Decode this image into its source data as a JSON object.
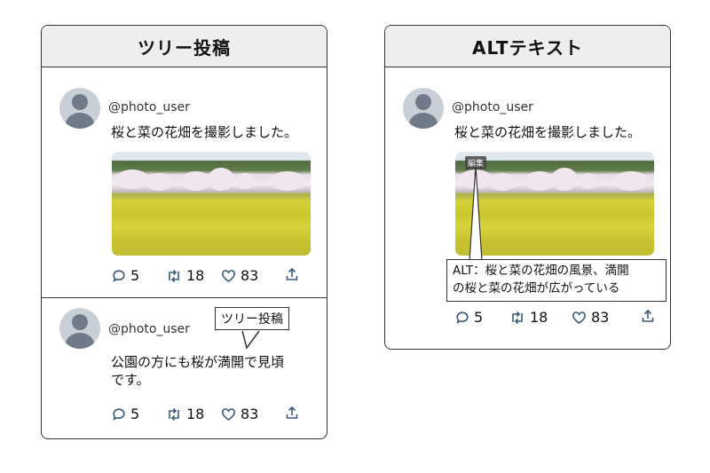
{
  "left_panel": {
    "title": "ツリー投稿",
    "tweet1": {
      "username": "@photo_user",
      "text": "桜と菜の花畑を撮影しました。",
      "replies": "5",
      "retweets": "18",
      "likes": "83"
    },
    "tweet2": {
      "username": "@photo_user",
      "text_line1": "公園の方にも桜が満開で見頃",
      "text_line2": "です。",
      "replies": "5",
      "retweets": "18",
      "likes": "83",
      "callout": "ツリー投稿"
    }
  },
  "right_panel": {
    "title": "ALTテキスト",
    "tweet": {
      "username": "@photo_user",
      "text": "桜と菜の花畑を撮影しました。",
      "edit_badge": "編集",
      "alt_line1": "ALT：桜と菜の花畑の風景、満開",
      "alt_line2": "の桜と菜の花畑が広がっている",
      "replies": "5",
      "retweets": "18",
      "likes": "83"
    }
  },
  "icons": {
    "reply": "speech-bubble-icon",
    "retweet": "retweet-icon",
    "like": "heart-icon",
    "share": "share-upload-icon",
    "avatar": "default-user-avatar"
  }
}
